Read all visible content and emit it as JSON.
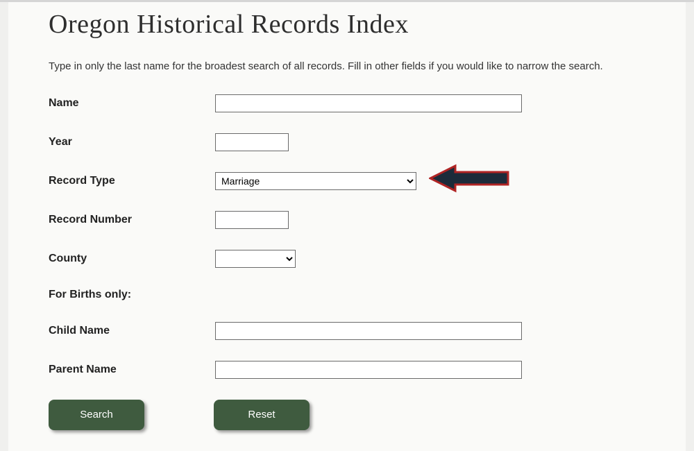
{
  "page": {
    "title": "Oregon Historical Records Index",
    "instructions": "Type in only the last name for the broadest search of all records. Fill in other fields if you would like to narrow the search."
  },
  "form": {
    "name": {
      "label": "Name",
      "value": ""
    },
    "year": {
      "label": "Year",
      "value": ""
    },
    "record_type": {
      "label": "Record Type",
      "selected": "Marriage"
    },
    "record_number": {
      "label": "Record Number",
      "value": ""
    },
    "county": {
      "label": "County",
      "selected": ""
    },
    "births_section": "For Births only:",
    "child_name": {
      "label": "Child Name",
      "value": ""
    },
    "parent_name": {
      "label": "Parent Name",
      "value": ""
    }
  },
  "buttons": {
    "search": "Search",
    "reset": "Reset"
  },
  "annotation": {
    "arrow_fill": "#1c2b3a",
    "arrow_stroke": "#b02424"
  }
}
